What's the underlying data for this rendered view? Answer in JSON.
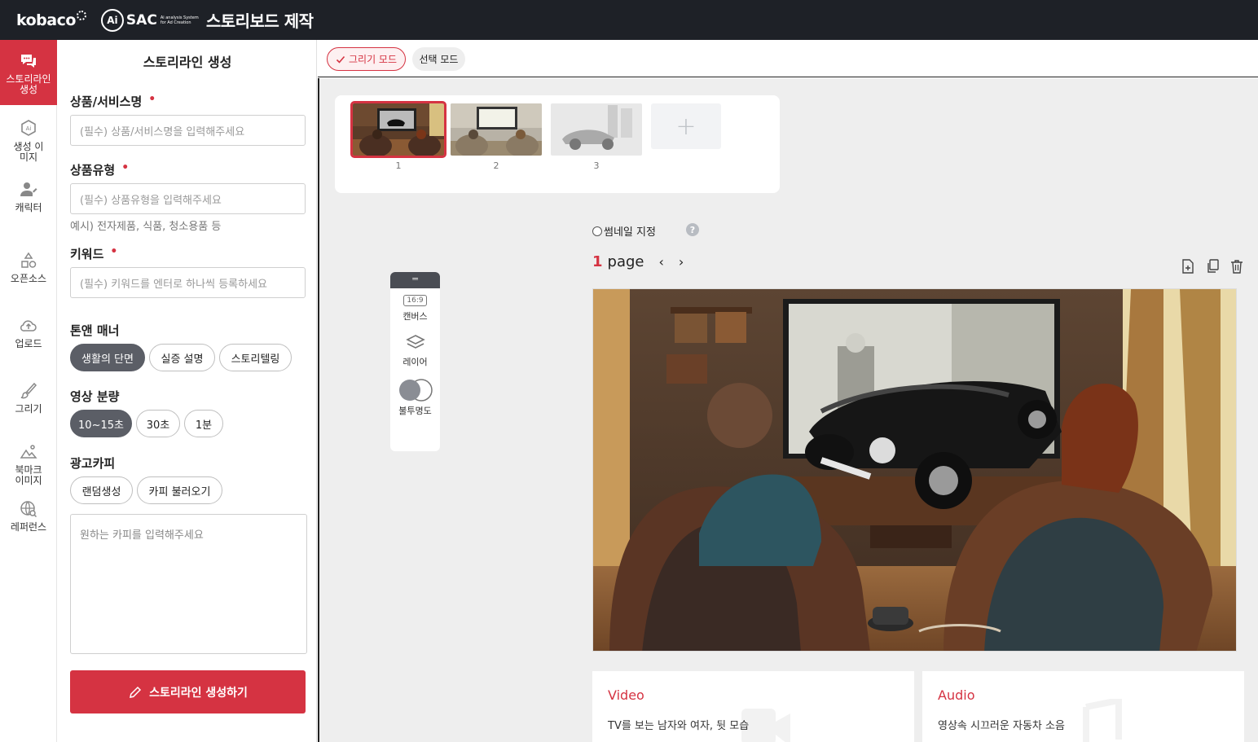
{
  "header": {
    "brand": "kobaco",
    "ai_badge": "Ai",
    "sac": "SAC",
    "sac_sub": "Ai analysis System for Ad Creation",
    "title": "스토리보드 제작"
  },
  "rail": {
    "items": [
      {
        "label": "스토리라인 생성",
        "icon": "chat-icon",
        "active": true
      },
      {
        "label": "생성 이미지",
        "icon": "ai-image-icon"
      },
      {
        "label": "캐릭터",
        "icon": "character-icon"
      },
      {
        "label": "오픈소스",
        "icon": "shapes-icon"
      },
      {
        "label": "업로드",
        "icon": "upload-icon"
      },
      {
        "label": "그리기",
        "icon": "brush-icon"
      },
      {
        "label": "북마크 이미지",
        "icon": "bookmark-image-icon"
      },
      {
        "label": "레퍼런스",
        "icon": "globe-icon"
      }
    ]
  },
  "panel": {
    "title": "스토리라인 생성",
    "product_name": {
      "label": "상품/서비스명",
      "required": "•",
      "placeholder": "(필수) 상품/서비스명을 입력해주세요"
    },
    "product_type": {
      "label": "상품유형",
      "required": "•",
      "placeholder": "(필수) 상품유형을 입력해주세요",
      "hint": "예시) 전자제품, 식품, 청소용품 등"
    },
    "keyword": {
      "label": "키워드",
      "required": "•",
      "placeholder": "(필수) 키워드를 엔터로 하나씩 등록하세요"
    },
    "tone": {
      "label": "톤앤 매너",
      "options": [
        "생활의 단면",
        "실증 설명",
        "스토리텔링"
      ],
      "selected": "생활의 단면"
    },
    "duration": {
      "label": "영상 분량",
      "options": [
        "10~15초",
        "30초",
        "1분"
      ],
      "selected": "10~15초"
    },
    "copy": {
      "label": "광고카피",
      "buttons": [
        "랜덤생성",
        "카피 불러오기"
      ],
      "placeholder": "원하는 카피를 입력해주세요"
    },
    "generate_button": "스토리라인 생성하기"
  },
  "modes": {
    "draw": "그리기 모드",
    "select": "선택 모드",
    "active": "draw"
  },
  "thumbnails": {
    "items": [
      "1",
      "2",
      "3"
    ],
    "selected": "1",
    "add": "+"
  },
  "toolbox": {
    "handle": "═",
    "tools": [
      {
        "label": "캔버스",
        "icon": "canvas-ratio-icon",
        "badge": "16:9"
      },
      {
        "label": "레이어",
        "icon": "layers-icon"
      },
      {
        "label": "불투명도",
        "icon": "opacity-icon"
      }
    ]
  },
  "thumb_setting": {
    "label": "썸네일 지정",
    "help": "?"
  },
  "pager": {
    "current": "1",
    "unit": "page",
    "prev": "‹",
    "next": "›"
  },
  "cards": {
    "video": {
      "title": "Video",
      "text": "TV를 보는 남자와 여자, 뒷 모습"
    },
    "audio": {
      "title": "Audio",
      "text": "영상속 시끄러운 자동차 소음"
    }
  },
  "colors": {
    "accent": "#d53342",
    "header": "#1e2127",
    "chip_selected": "#5b5e66"
  }
}
